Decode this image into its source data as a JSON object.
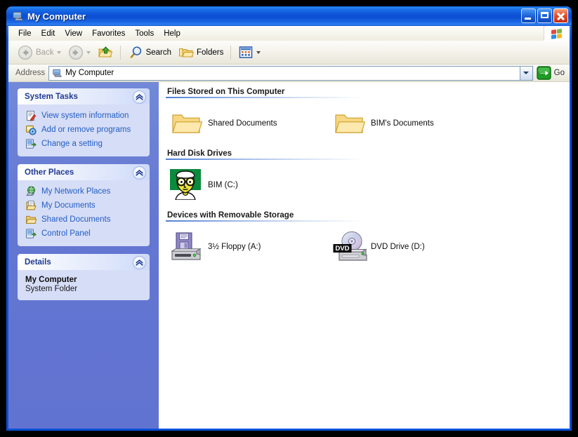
{
  "window": {
    "title": "My Computer",
    "title_icon": "my-computer-icon",
    "buttons": {
      "minimize": "Minimize",
      "maximize": "Maximize",
      "close": "Close"
    }
  },
  "menubar": {
    "items": [
      {
        "label": "File"
      },
      {
        "label": "Edit"
      },
      {
        "label": "View"
      },
      {
        "label": "Favorites"
      },
      {
        "label": "Tools"
      },
      {
        "label": "Help"
      }
    ],
    "brand_icon": "windows-flag-icon"
  },
  "toolbar": {
    "back": {
      "label": "Back",
      "icon": "back-arrow-icon",
      "enabled": false
    },
    "forward": {
      "icon": "forward-arrow-icon",
      "enabled": false
    },
    "up": {
      "icon": "up-folder-icon"
    },
    "search": {
      "label": "Search",
      "icon": "search-icon"
    },
    "folders": {
      "label": "Folders",
      "icon": "folders-icon"
    },
    "views": {
      "icon": "views-icon"
    }
  },
  "address": {
    "label": "Address",
    "value": "My Computer",
    "icon": "my-computer-icon",
    "dropdown_icon": "chevron-down-icon",
    "go_label": "Go",
    "go_icon": "go-arrow-icon"
  },
  "sidebar": {
    "panels": [
      {
        "title": "System Tasks",
        "collapse_icon": "chevron-up-icon",
        "items": [
          {
            "label": "View system information",
            "icon": "system-info-icon"
          },
          {
            "label": "Add or remove programs",
            "icon": "add-remove-programs-icon"
          },
          {
            "label": "Change a setting",
            "icon": "change-setting-icon"
          }
        ]
      },
      {
        "title": "Other Places",
        "collapse_icon": "chevron-up-icon",
        "items": [
          {
            "label": "My Network Places",
            "icon": "network-places-icon"
          },
          {
            "label": "My Documents",
            "icon": "my-documents-icon"
          },
          {
            "label": "Shared Documents",
            "icon": "shared-folder-icon"
          },
          {
            "label": "Control Panel",
            "icon": "control-panel-icon"
          }
        ]
      },
      {
        "title": "Details",
        "collapse_icon": "chevron-up-icon",
        "detail_name": "My Computer",
        "detail_type": "System Folder"
      }
    ]
  },
  "content": {
    "sections": [
      {
        "heading": "Files Stored on This Computer",
        "items": [
          {
            "label": "Shared Documents",
            "icon": "shared-documents-folder-icon"
          },
          {
            "label": "BIM's Documents",
            "icon": "user-documents-folder-icon"
          }
        ]
      },
      {
        "heading": "Hard Disk Drives",
        "items": [
          {
            "label": "BIM (C:)",
            "icon": "custom-face-drive-icon"
          }
        ]
      },
      {
        "heading": "Devices with Removable Storage",
        "items": [
          {
            "label": "3½ Floppy (A:)",
            "icon": "floppy-drive-icon"
          },
          {
            "label": "DVD Drive (D:)",
            "icon": "dvd-drive-icon"
          }
        ]
      }
    ]
  },
  "colors": {
    "titlebar_blue": "#0a4fd8",
    "sidebar_blue": "#6376d2",
    "panel_body": "#d6ddf6",
    "link_blue": "#215dc6",
    "panel_title": "#1f3a93",
    "go_green": "#17a81a"
  }
}
